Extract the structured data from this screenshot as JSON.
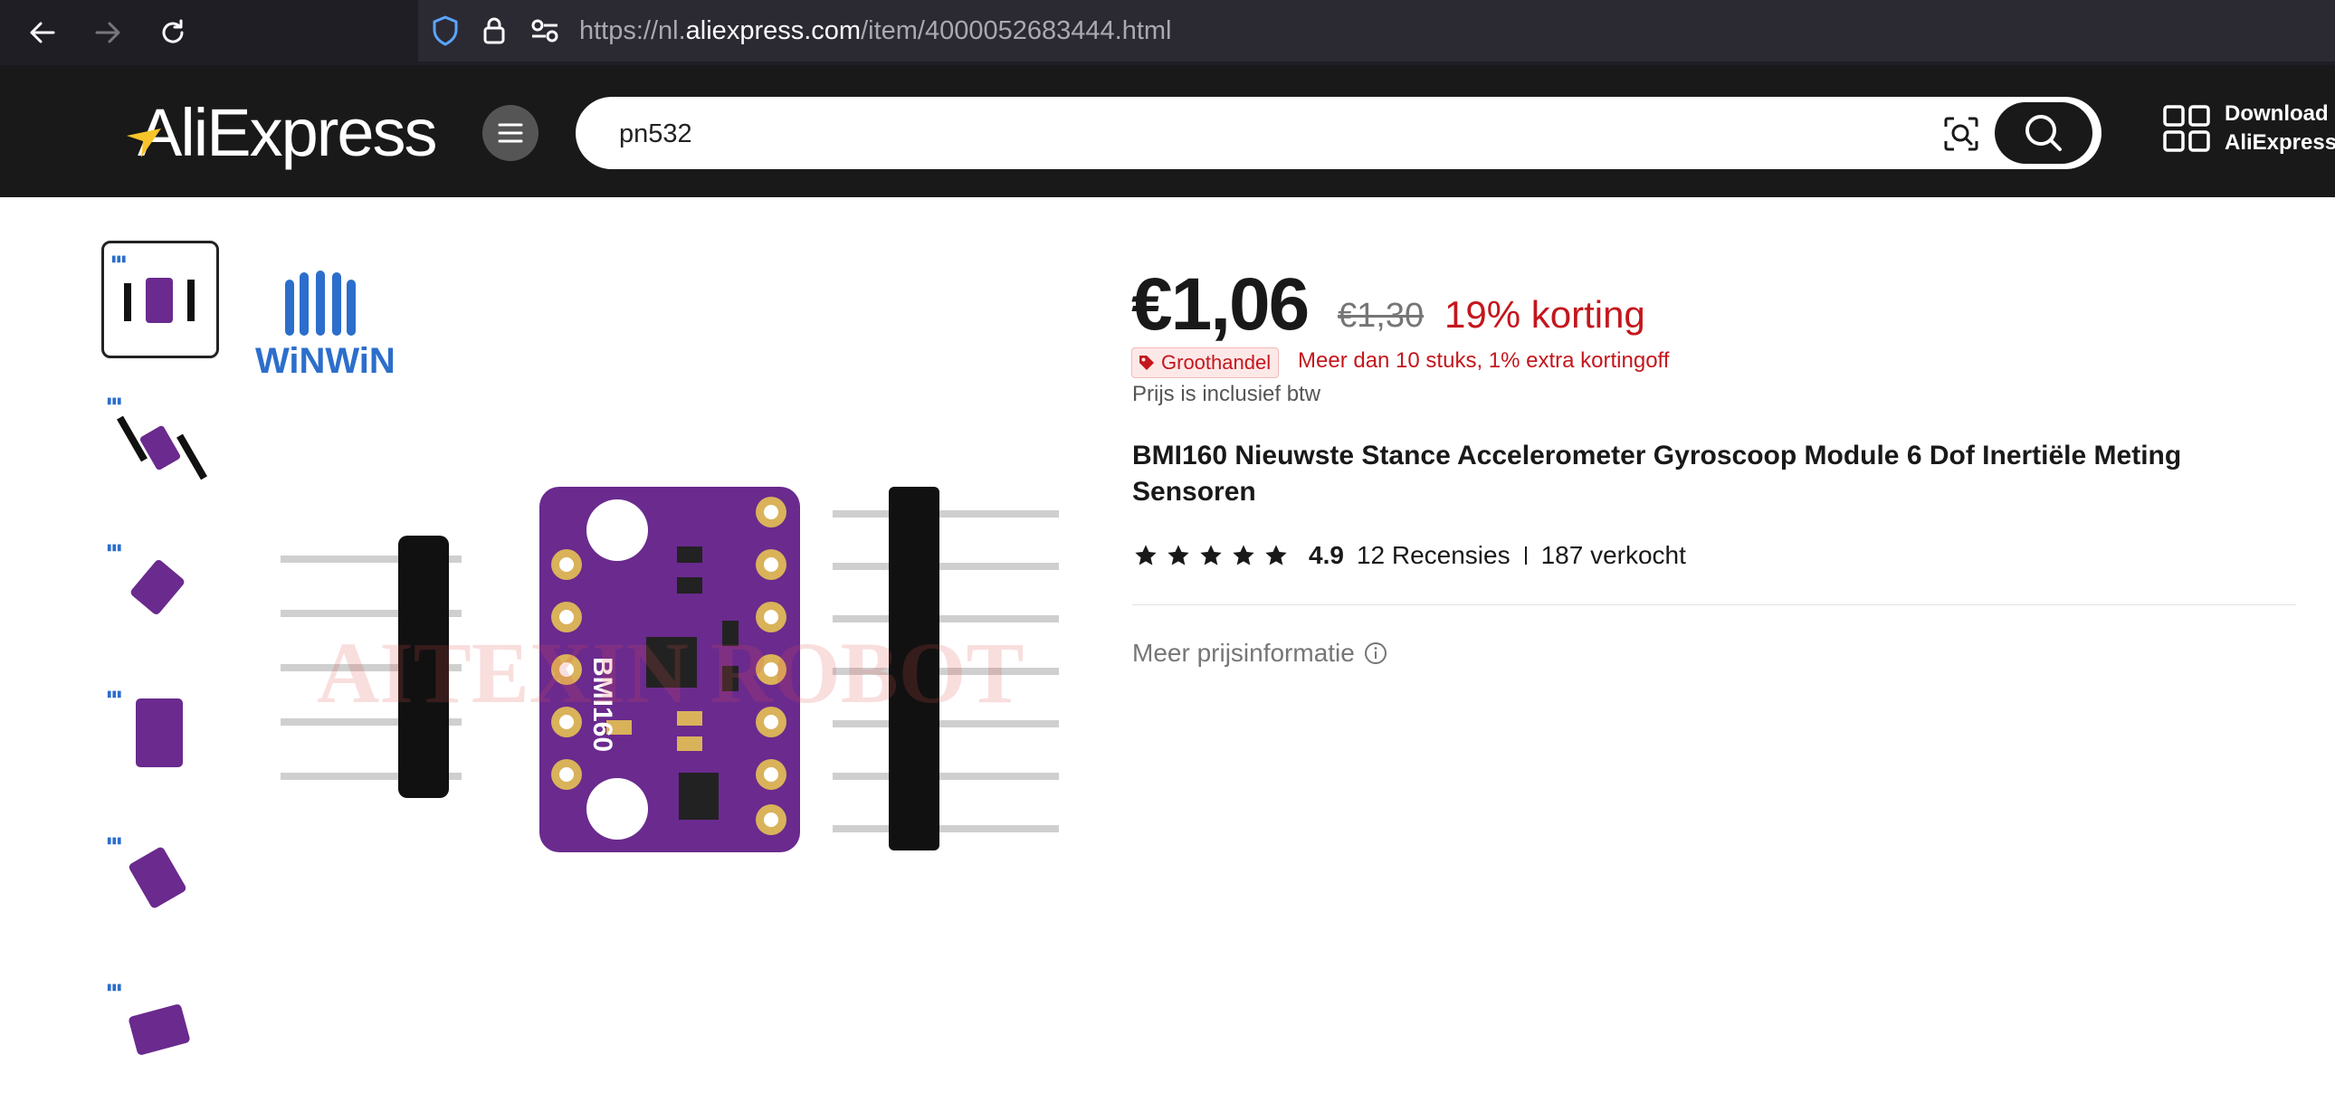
{
  "browser": {
    "url_prefix": "https://nl.",
    "url_host": "aliexpress.com",
    "url_path": "/item/4000052683444.html"
  },
  "header": {
    "logo_text": "AliExpress",
    "search_value": "pn532",
    "download_line1": "Download d",
    "download_line2": "AliExpress-"
  },
  "gallery": {
    "brand_text": "WiNWiN",
    "watermark": "AITEXIN ROBOT",
    "chip_label": "BMI160",
    "thumbnails": [
      "thumb-1",
      "thumb-2",
      "thumb-3",
      "thumb-4",
      "thumb-5",
      "thumb-6"
    ]
  },
  "product": {
    "price": "€1,06",
    "original_price": "€1,30",
    "discount": "19% korting",
    "wholesale_badge": "Groothandel",
    "wholesale_info": "Meer dan 10 stuks, 1% extra kortingoff",
    "vat_note": "Prijs is inclusief btw",
    "title": "BMI160 Nieuwste Stance Accelerometer Gyroscoop Module 6 Dof Inertiële Meting Sensoren",
    "rating": "4.9",
    "reviews": "12 Recensies",
    "sold": "187 verkocht",
    "more_price_info": "Meer prijsinformatie"
  },
  "colors": {
    "accent_red": "#c4161c",
    "header_bg": "#191919",
    "pcb_purple": "#6a2a8e"
  }
}
